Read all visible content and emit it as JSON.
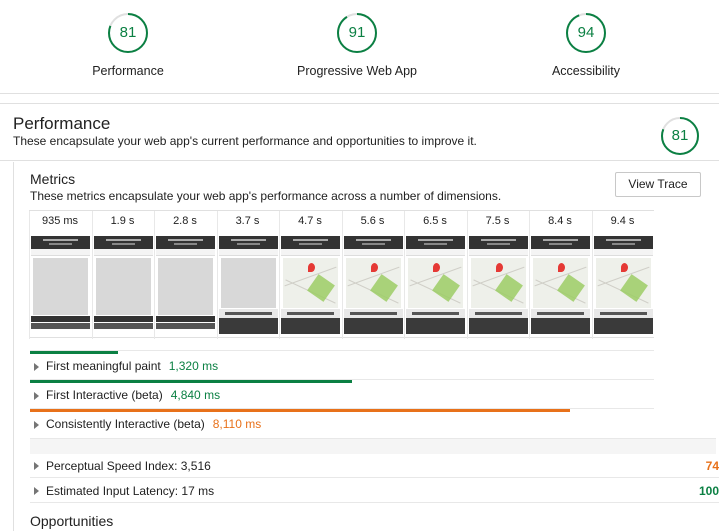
{
  "scores": [
    {
      "value": "81",
      "label": "Performance",
      "fraction": 0.81
    },
    {
      "value": "91",
      "label": "Progressive Web App",
      "fraction": 0.91
    },
    {
      "value": "94",
      "label": "Accessibility",
      "fraction": 0.94
    }
  ],
  "performance": {
    "title": "Performance",
    "description": "These encapsulate your web app's current performance and opportunities to improve it.",
    "score": "81",
    "score_fraction": 0.81
  },
  "metrics": {
    "title": "Metrics",
    "description": "These metrics encapsulate your web app's performance across a number of dimensions.",
    "view_trace_label": "View Trace"
  },
  "filmstrip": [
    {
      "time": "935 ms",
      "state": "grey"
    },
    {
      "time": "1.9 s",
      "state": "grey"
    },
    {
      "time": "2.8 s",
      "state": "grey"
    },
    {
      "time": "3.7 s",
      "state": "partial"
    },
    {
      "time": "4.7 s",
      "state": "map"
    },
    {
      "time": "5.6 s",
      "state": "map"
    },
    {
      "time": "6.5 s",
      "state": "map"
    },
    {
      "time": "7.5 s",
      "state": "map"
    },
    {
      "time": "8.4 s",
      "state": "map"
    },
    {
      "time": "9.4 s",
      "state": "map"
    }
  ],
  "timeline_metrics": [
    {
      "name": "First meaningful paint",
      "value": "1,320 ms",
      "status": "pass",
      "color": "#0b8043",
      "fraction": 0.141
    },
    {
      "name": "First Interactive (beta)",
      "value": "4,840 ms",
      "status": "pass",
      "color": "#0b8043",
      "fraction": 0.516
    },
    {
      "name": "Consistently Interactive (beta)",
      "value": "8,110 ms",
      "status": "average",
      "color": "#e8711a",
      "fraction": 0.865
    }
  ],
  "other_metrics": [
    {
      "name": "Perceptual Speed Index: 3,516",
      "score": "74",
      "color": "#e8711a"
    },
    {
      "name": "Estimated Input Latency: 17 ms",
      "score": "100",
      "color": "#0b8043"
    }
  ],
  "opportunities": {
    "title": "Opportunities"
  },
  "colors": {
    "pass": "#0b8043",
    "average": "#e8711a",
    "border": "#e0e0e0"
  }
}
